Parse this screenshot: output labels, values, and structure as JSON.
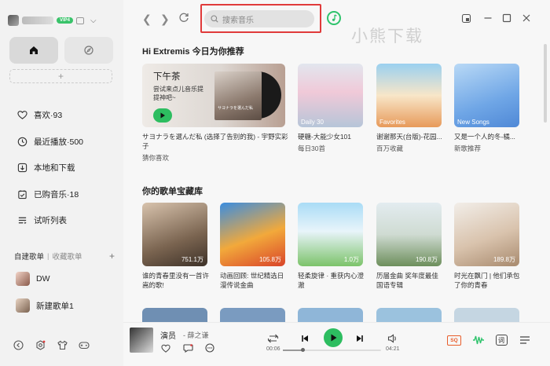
{
  "user": {
    "vip_label": "VIP4"
  },
  "sidebar": {
    "menu": [
      {
        "label": "喜欢·93",
        "icon": "heart-icon"
      },
      {
        "label": "最近播放·500",
        "icon": "clock-icon"
      },
      {
        "label": "本地和下载",
        "icon": "download-icon"
      },
      {
        "label": "已购音乐·18",
        "icon": "purchased-icon"
      },
      {
        "label": "试听列表",
        "icon": "list-icon"
      }
    ],
    "section_created": "自建歌单",
    "section_separator": "|",
    "section_collected": "收藏歌单",
    "add_symbol": "+",
    "playlists": [
      {
        "label": "DW"
      },
      {
        "label": "新建歌单1"
      }
    ]
  },
  "topbar": {
    "search_placeholder": "搜索音乐",
    "watermark": "小熊下载"
  },
  "recommend": {
    "heading": "Hi Extremis 今日为你推荐",
    "feature": {
      "title": "下午茶",
      "subtitle": "尝试来点儿音乐提提神吧~",
      "cover_text": "サヨナラを選んだ私",
      "desc_line1": "サヨナラを選んだ私 (选择了告别的我) - 宇野实彩子",
      "desc_line2": "猜你喜欢"
    },
    "cards": [
      {
        "label": "Daily 30",
        "title": "硬糖-大能少女101",
        "sub": "每日30首",
        "colors": [
          "#cfd9ea",
          "#e7a8c3"
        ]
      },
      {
        "label": "Favorites",
        "title": "谢谢那天(台版)-花园...",
        "sub": "百万收藏",
        "colors": [
          "#8dc6e8",
          "#f5b96f"
        ]
      },
      {
        "label": "New Songs",
        "title": "又是一个人的冬-橘...",
        "sub": "新歌推荐",
        "colors": [
          "#6aa4e8",
          "#b9d8f7"
        ]
      }
    ]
  },
  "library": {
    "heading": "你的歌单宝藏库",
    "cards": [
      {
        "count": "751.1万",
        "title": "谁的青春里没有一首许嵩的歌!",
        "colors": [
          "#5a4a3a",
          "#c8a98c"
        ]
      },
      {
        "count": "105.8万",
        "title": "动画回顾: 世纪精选日漫传说金曲",
        "colors": [
          "#2a7fd1",
          "#f49b2a"
        ]
      },
      {
        "count": "1.0万",
        "title": "轻柔旋律 · 重获内心澄澈",
        "colors": [
          "#8ad0f0",
          "#6fbf5a"
        ]
      },
      {
        "count": "190.8万",
        "title": "历届金曲 奖年度最佳国语专辑",
        "colors": [
          "#d7e4ea",
          "#7a9a6a"
        ]
      },
      {
        "count": "189.8万",
        "title": "时光在飘门 | 他们承包了你的青春",
        "colors": [
          "#e9e4df",
          "#c9a88a"
        ]
      }
    ]
  },
  "player": {
    "song": "演员",
    "artist": "- 薛之谦",
    "time_current": "00:06",
    "time_total": "04:21",
    "progress": 0.2,
    "quality": "SQ",
    "lyrics_label": "词"
  }
}
